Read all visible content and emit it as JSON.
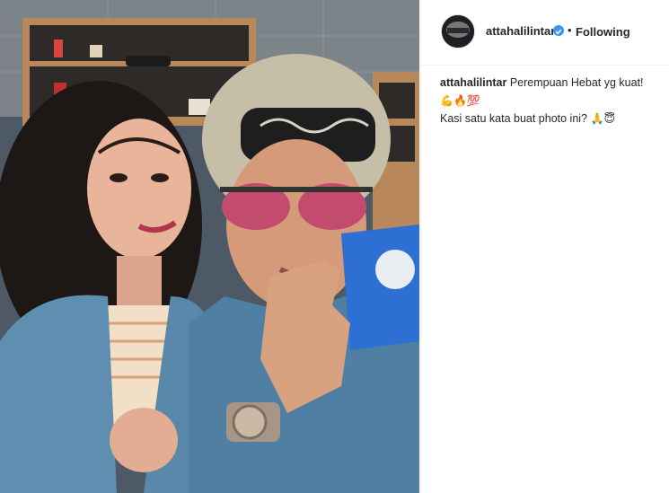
{
  "post": {
    "username": "attahalilintar",
    "follow_status": "Following",
    "separator": "•",
    "caption_username": "attahalilintar",
    "caption_line1": "Perempuan Hebat yg kuat!",
    "caption_emojis1": "💪🔥💯",
    "caption_line2": "Kasi satu kata buat photo ini?",
    "caption_emojis2": "🙏😇"
  },
  "icons": {
    "verified": "verified-badge-icon"
  },
  "colors": {
    "verified": "#3897f0",
    "text": "#262626",
    "border": "#efefef"
  }
}
